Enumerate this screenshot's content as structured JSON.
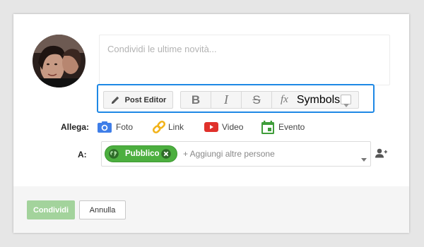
{
  "compose": {
    "placeholder": "Condividi le ultime novità..."
  },
  "toolbar": {
    "post_editor_label": "Post Editor",
    "symbols_label": "Symbols",
    "icons": [
      "pencil-icon",
      "bold-icon",
      "italic-icon",
      "strikethrough-icon",
      "function-icon",
      "chevron-down-icon"
    ]
  },
  "attach": {
    "label": "Allega:",
    "items": [
      {
        "label": "Foto",
        "icon": "camera-icon",
        "color": "#3f7ee8"
      },
      {
        "label": "Link",
        "icon": "link-icon",
        "color": "#f2b31a"
      },
      {
        "label": "Video",
        "icon": "youtube-icon",
        "color": "#e0312b"
      },
      {
        "label": "Evento",
        "icon": "calendar-icon",
        "color": "#3f9d3a"
      }
    ]
  },
  "recipients": {
    "label": "A:",
    "chip_label": "Pubblico",
    "input_placeholder": "+ Aggiungi altre persone",
    "chip_color": "#4caf3f"
  },
  "footer": {
    "share_label": "Condividi",
    "cancel_label": "Annulla",
    "share_color": "#a3d39c"
  },
  "accent": "#1e88e5"
}
